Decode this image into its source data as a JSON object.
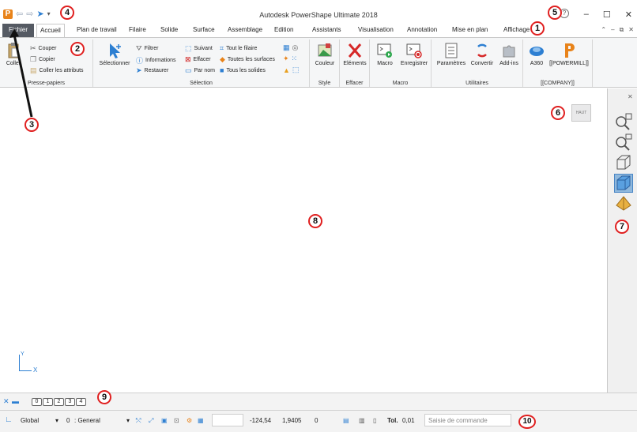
{
  "window": {
    "title": "Autodesk PowerShape Ultimate 2018"
  },
  "tabs": [
    {
      "label": "Fichier"
    },
    {
      "label": "Accueil"
    },
    {
      "label": "Plan de travail"
    },
    {
      "label": "Filaire"
    },
    {
      "label": "Solide"
    },
    {
      "label": "Surface"
    },
    {
      "label": "Assemblage"
    },
    {
      "label": "Edition"
    },
    {
      "label": "Assistants"
    },
    {
      "label": "Visualisation"
    },
    {
      "label": "Annotation"
    },
    {
      "label": "Mise en plan"
    },
    {
      "label": "Affichage"
    }
  ],
  "ribbon": {
    "clipboard": {
      "label": "Presse-papiers",
      "paste": "Coller",
      "cut": "Couper",
      "copy": "Copier",
      "paste_attrs": "Coller les attributs"
    },
    "selection": {
      "label": "Sélection",
      "select": "Sélectionner",
      "filter": "Filtrer",
      "info": "Informations",
      "restore": "Restaurer",
      "next": "Suivant",
      "clear": "Effacer",
      "by_name": "Par nom",
      "all_wire": "Tout le filaire",
      "all_surfaces": "Toutes les surfaces",
      "all_solids": "Tous les solides"
    },
    "style": {
      "label": "Style",
      "color": "Couleur"
    },
    "erase": {
      "label": "Effacer",
      "elements": "Eléments"
    },
    "macro": {
      "label": "Macro",
      "macro": "Macro",
      "record": "Enregistrer"
    },
    "utilities": {
      "label": "Utilitaires",
      "params": "Paramètres",
      "convert": "Convertir",
      "addins": "Add-ins"
    },
    "company": {
      "label": "[[COMPANY]]",
      "a360": "A360",
      "powermill": "[[POWERMILL]]"
    }
  },
  "viewport": {
    "view_cube_label": "HAUT",
    "axis_x": "X",
    "axis_y": "Y"
  },
  "layers": [
    "0",
    "1",
    "2",
    "3",
    "4"
  ],
  "status": {
    "coord_system": "Global",
    "level": "0",
    "level_name": ": General",
    "x": "-124,54",
    "y": "1,9405",
    "z": "0",
    "tol_label": "Tol.",
    "tol_value": "0,01",
    "command_placeholder": "Saisie de commande"
  },
  "callouts": [
    "1",
    "2",
    "3",
    "4",
    "5",
    "6",
    "7",
    "8",
    "9",
    "10"
  ],
  "colors": {
    "file_tab": "#555a63",
    "accent_blue": "#2d7fd2",
    "callout_red": "#e02020",
    "logo_orange": "#e8831a"
  }
}
